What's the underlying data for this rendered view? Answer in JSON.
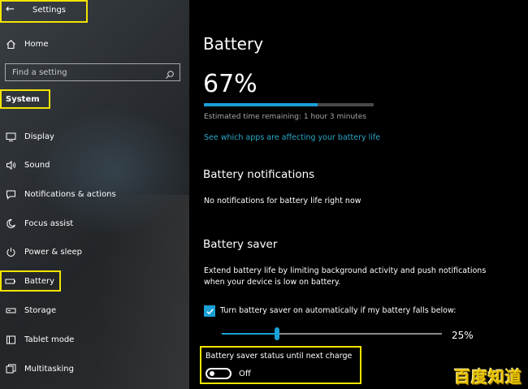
{
  "window": {
    "back_glyph": "←",
    "title": "Settings"
  },
  "sidebar": {
    "home": {
      "label": "Home",
      "icon": "home-icon"
    },
    "search": {
      "placeholder": "Find a setting",
      "icon": "search-icon"
    },
    "section": "System",
    "items": [
      {
        "label": "Display",
        "icon": "display-icon"
      },
      {
        "label": "Sound",
        "icon": "speaker-icon"
      },
      {
        "label": "Notifications & actions",
        "icon": "notification-icon"
      },
      {
        "label": "Focus assist",
        "icon": "moon-icon"
      },
      {
        "label": "Power & sleep",
        "icon": "power-icon"
      },
      {
        "label": "Battery",
        "icon": "battery-icon",
        "selected": true
      },
      {
        "label": "Storage",
        "icon": "storage-icon"
      },
      {
        "label": "Tablet mode",
        "icon": "tablet-icon"
      },
      {
        "label": "Multitasking",
        "icon": "multitasking-icon"
      }
    ]
  },
  "main": {
    "title": "Battery",
    "percent_text": "67%",
    "percent_value": 67,
    "estimate": "Estimated time remaining: 1 hour 3 minutes",
    "apps_link": "See which apps are affecting your battery life",
    "notifications": {
      "heading": "Battery notifications",
      "text": "No notifications for battery life right now"
    },
    "saver": {
      "heading": "Battery saver",
      "description": "Extend battery life by limiting background activity and push notifications when your device is low on battery.",
      "auto_label": "Turn battery saver on automatically if my battery falls below:",
      "auto_checked": true,
      "threshold_text": "25%",
      "threshold_value": 25,
      "status_label": "Battery saver status until next charge",
      "status_value": "Off",
      "status_on": false
    }
  },
  "watermark": "百度知道",
  "colors": {
    "accent": "#1aa0d6",
    "highlight": "#f2e400",
    "link": "#2aa8c8"
  }
}
